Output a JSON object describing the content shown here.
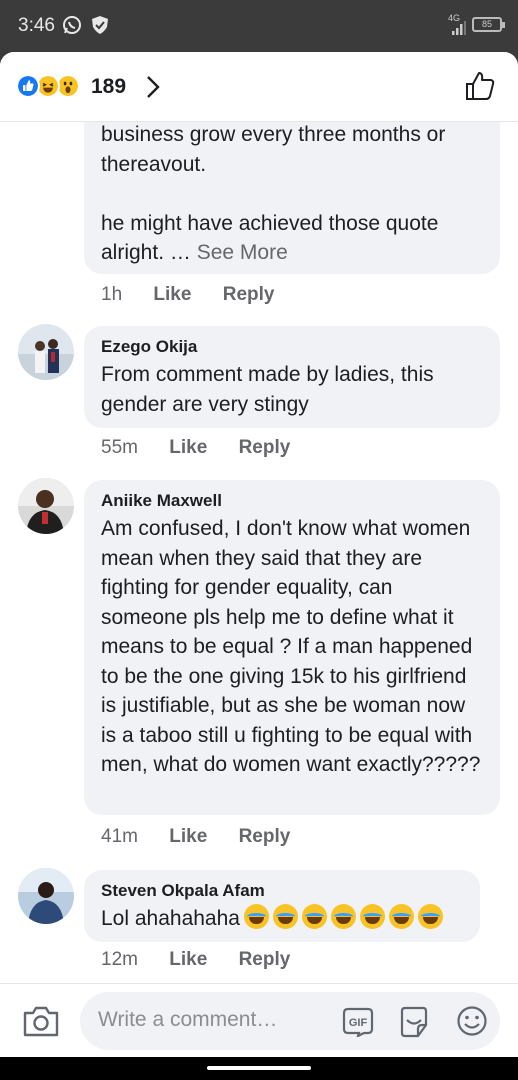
{
  "status_bar": {
    "time": "3:46",
    "network": "4G",
    "battery": "85"
  },
  "header": {
    "reaction_icons": [
      "like-reaction-icon",
      "haha-reaction-icon",
      "wow-reaction-icon"
    ],
    "reaction_count": "189"
  },
  "comments": [
    {
      "author": "",
      "text": "business grow every three months or thereavout.\n\nhe might have achieved those quote alright. … ",
      "see_more": "See More",
      "time": "1h",
      "like": "Like",
      "reply": "Reply"
    },
    {
      "author": "Ezego Okija",
      "text": "From comment made by ladies, this gender are very stingy",
      "time": "55m",
      "like": "Like",
      "reply": "Reply"
    },
    {
      "author": "Aniike Maxwell",
      "text": "Am confused, I don't know what women mean when they said that they are fighting for gender equality, can someone pls help me to define what it means to be equal ? If a man happened to be the one giving 15k to his girlfriend is justifiable, but as she be woman now is a taboo still u fighting to be equal with men, what do women want exactly?????",
      "time": "41m",
      "like": "Like",
      "reply": "Reply"
    },
    {
      "author": "Steven Okpala Afam",
      "text": "Lol ahahahaha",
      "emoji_count": 7,
      "time": "12m",
      "like": "Like",
      "reply": "Reply"
    }
  ],
  "composer": {
    "placeholder": "Write a comment…",
    "gif_label": "GIF"
  },
  "colors": {
    "facebook_blue": "#1877f2",
    "bubble": "#f0f2f5",
    "meta_gray": "#65676b"
  }
}
